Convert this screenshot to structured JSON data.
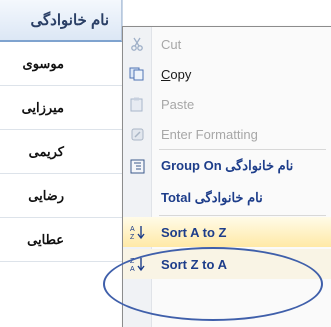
{
  "column": {
    "header": "نام خانوادگی",
    "cells": [
      "موسوی",
      "میرزایی",
      "کریمی",
      "رضایی",
      "عطایی"
    ]
  },
  "menu": {
    "items": [
      {
        "label": "Cut",
        "icon": "scissors-icon",
        "disabled": true
      },
      {
        "label": "Copy",
        "icon": "copy-icon",
        "disabled": false
      },
      {
        "label": "Paste",
        "icon": "paste-icon",
        "disabled": true
      },
      {
        "label": "Enter Formatting",
        "icon": "formatting-icon",
        "disabled": true
      },
      {
        "label": "Group On نام خانوادگی",
        "icon": "group-icon",
        "disabled": false
      },
      {
        "label": "Total نام خانوادگی",
        "icon": "",
        "disabled": false
      },
      {
        "label": "Sort A to Z",
        "icon": "sort-ascending-icon",
        "disabled": false
      },
      {
        "label": "Sort Z to A",
        "icon": "sort-descending-icon",
        "disabled": false
      }
    ]
  },
  "colors": {
    "header_text": "#2a3f66",
    "menu_blue": "#1d3d8a",
    "highlight_oval": "#3f5faa",
    "sort_highlight": "#ffe9a6"
  }
}
